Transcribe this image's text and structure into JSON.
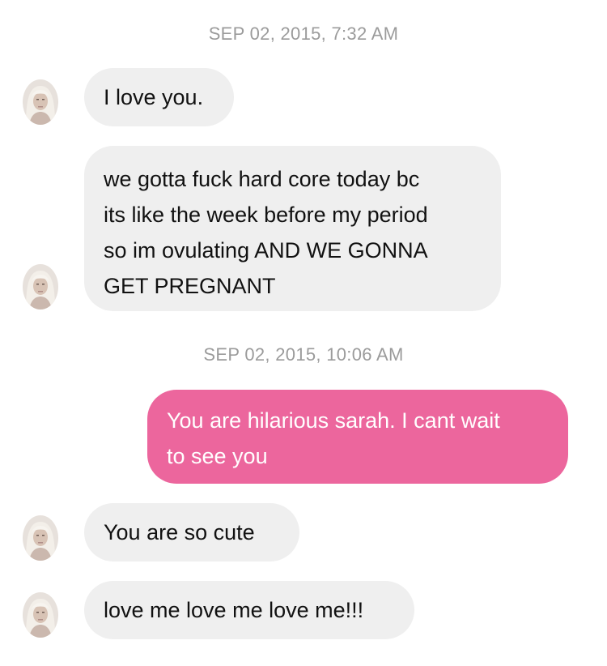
{
  "thread": {
    "timestamp_1": "SEP 02, 2015, 7:32 AM",
    "timestamp_2": "SEP 02, 2015, 10:06 AM",
    "messages": [
      {
        "side": "received",
        "lines": [
          "I love you."
        ]
      },
      {
        "side": "received",
        "lines": [
          "we gotta fuck hard core today bc",
          "its like the week before my period",
          "so im ovulating AND WE GONNA",
          "GET PREGNANT"
        ]
      },
      {
        "side": "sent",
        "lines": [
          "You are hilarious sarah. I cant wait",
          "to see you"
        ]
      },
      {
        "side": "received",
        "lines": [
          "You are so cute"
        ]
      },
      {
        "side": "received",
        "lines": [
          "love me love me love me!!!"
        ]
      }
    ]
  },
  "avatar_icon": "contact-avatar-photo",
  "colors": {
    "received_bubble": "#efefef",
    "sent_bubble": "#ec669d",
    "timestamp_text": "#9b9b9b"
  }
}
